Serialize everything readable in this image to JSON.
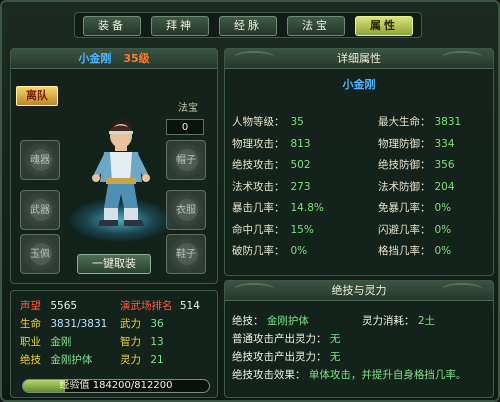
{
  "tabs": [
    {
      "label": "装备",
      "active": false
    },
    {
      "label": "拜神",
      "active": false
    },
    {
      "label": "经脉",
      "active": false
    },
    {
      "label": "法宝",
      "active": false
    },
    {
      "label": "属性",
      "active": true
    }
  ],
  "character": {
    "name": "小金刚",
    "level": "35级",
    "team_button": "离队",
    "fabao_label": "法宝",
    "fabao_value": "0",
    "slots": {
      "hunqi": "魂器",
      "wuqi": "武器",
      "yupei": "玉佩",
      "maozi": "帽子",
      "yifu": "衣服",
      "xiezi": "鞋子"
    },
    "unequip_button": "一键取装"
  },
  "basic_stats": {
    "reputation_label": "声望",
    "reputation_value": "5565",
    "arena_label": "演武场排名",
    "arena_value": "514",
    "hp_label": "生命",
    "hp_value": "3831/3831",
    "force_label": "武力",
    "force_value": "36",
    "job_label": "职业",
    "job_value": "金刚",
    "int_label": "智力",
    "int_value": "13",
    "skill_label": "绝技",
    "skill_value": "金刚护体",
    "spirit_label": "灵力",
    "spirit_value": "21"
  },
  "xp": {
    "label": "经验值",
    "current": 184200,
    "max": 812200,
    "text": "经验值 184200/812200"
  },
  "detail": {
    "title": "详细属性",
    "name": "小金刚",
    "rows": [
      {
        "k1": "人物等级：",
        "v1": "35",
        "k2": "最大生命：",
        "v2": "3831"
      },
      {
        "k1": "物理攻击：",
        "v1": "813",
        "k2": "物理防御：",
        "v2": "334"
      },
      {
        "k1": "绝技攻击：",
        "v1": "502",
        "k2": "绝技防御：",
        "v2": "356"
      },
      {
        "k1": "法术攻击：",
        "v1": "273",
        "k2": "法术防御：",
        "v2": "204"
      },
      {
        "k1": "暴击几率：",
        "v1": "14.8%",
        "k2": "免暴几率：",
        "v2": "0%"
      },
      {
        "k1": "命中几率：",
        "v1": "15%",
        "k2": "闪避几率：",
        "v2": "0%"
      },
      {
        "k1": "破防几率：",
        "v1": "0%",
        "k2": "格挡几率：",
        "v2": "0%"
      }
    ]
  },
  "skill_panel": {
    "title": "绝技与灵力",
    "skill_label": "绝技：",
    "skill_value": "金刚护体",
    "cost_label": "灵力消耗：",
    "cost_value": "2土",
    "normal_label": "普通攻击产出灵力：",
    "normal_value": "无",
    "skill_gen_label": "绝技攻击产出灵力：",
    "skill_gen_value": "无",
    "effect_label": "绝技攻击效果：",
    "effect_value": "单体攻击，并提升自身格挡几率。"
  }
}
